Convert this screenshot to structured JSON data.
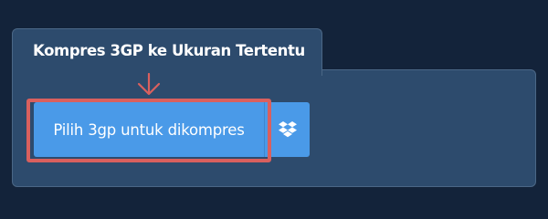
{
  "panel": {
    "tab_title": "Kompres 3GP ke Ukuran Tertentu"
  },
  "upload": {
    "button_label": "Pilih 3gp untuk dikompres",
    "dropbox_icon": "dropbox-icon"
  },
  "colors": {
    "background": "#13233a",
    "panel": "#2d4b6d",
    "button": "#4a9ae8",
    "highlight": "#d9605e"
  }
}
